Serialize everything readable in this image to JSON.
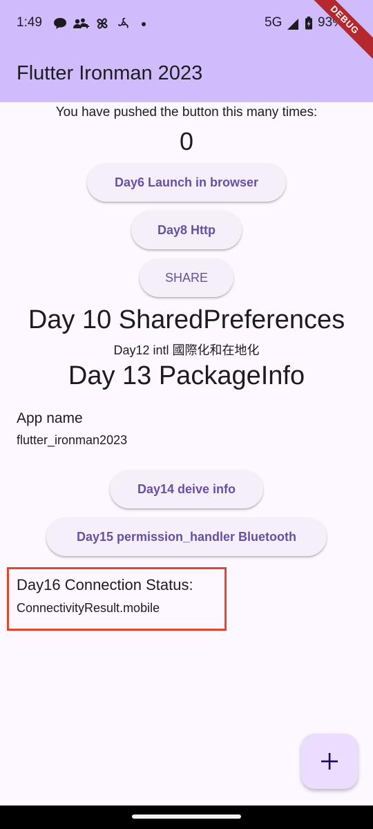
{
  "status_bar": {
    "time": "1:49",
    "network": "5G",
    "battery": "93%",
    "icons": [
      "chat-bubble-icon",
      "people-icon",
      "pinwheel-icon",
      "fan-icon",
      "dot-icon",
      "signal-icon",
      "battery-icon"
    ]
  },
  "debug_banner": "DEBUG",
  "app_bar": {
    "title": "Flutter Ironman 2023"
  },
  "counter": {
    "label": "You have pushed the button this many times:",
    "value": "0"
  },
  "buttons": {
    "day6": "Day6 Launch in browser",
    "day8": "Day8 Http",
    "share": "SHARE",
    "day14": "Day14 deive info",
    "day15": "Day15 permission_handler Bluetooth"
  },
  "day10": "Day 10 SharedPreferences",
  "day12": "Day12 intl 國際化和在地化",
  "day13": "Day 13 PackageInfo",
  "package_info": {
    "label": "App name",
    "value": "flutter_ironman2023"
  },
  "connection": {
    "label": "Day16 Connection Status:",
    "value": "ConnectivityResult.mobile"
  },
  "fab": {
    "icon": "plus-icon"
  },
  "colors": {
    "app_bar": "#d0bcfd",
    "background": "#fdf7ff",
    "button_text": "#6750a4",
    "button_bg": "#f5effa",
    "highlight_border": "#e3452c",
    "fab_bg": "#eaddff"
  }
}
